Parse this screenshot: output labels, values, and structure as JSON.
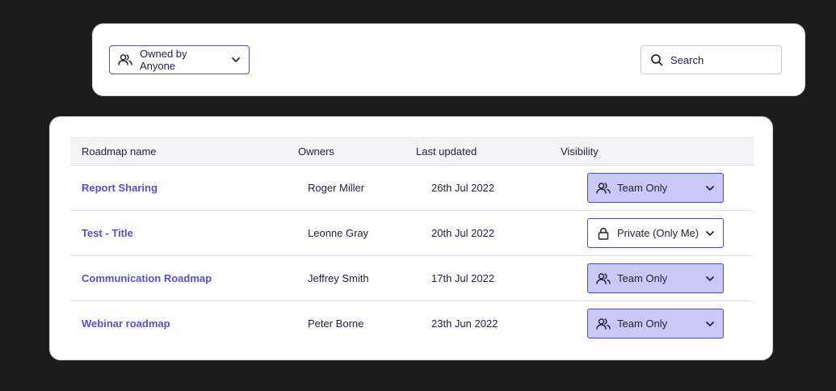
{
  "filters": {
    "owner_filter_label": "Owned by Anyone",
    "search_placeholder": "Search"
  },
  "table": {
    "headers": {
      "name": "Roadmap name",
      "owners": "Owners",
      "last_updated": "Last updated",
      "visibility": "Visibility"
    },
    "rows": [
      {
        "name": "Report Sharing",
        "owner": "Roger Miller",
        "updated": "26th Jul 2022",
        "visibility": "Team Only",
        "visibility_icon": "people-icon"
      },
      {
        "name": "Test - Title",
        "owner": "Leonne Gray",
        "updated": "20th Jul 2022",
        "visibility": "Private (Only Me)",
        "visibility_icon": "lock-icon"
      },
      {
        "name": "Communication Roadmap",
        "owner": "Jeffrey Smith",
        "updated": "17th Jul 2022",
        "visibility": "Team Only",
        "visibility_icon": "people-icon"
      },
      {
        "name": "Webinar roadmap",
        "owner": "Peter Borne",
        "updated": "23th Jun 2022",
        "visibility": "Team Only",
        "visibility_icon": "people-icon"
      }
    ]
  },
  "colors": {
    "background": "#1b1b1c",
    "accent": "#5651c7",
    "team_badge_fill": "#c9c8f6",
    "text": "#22243a"
  }
}
